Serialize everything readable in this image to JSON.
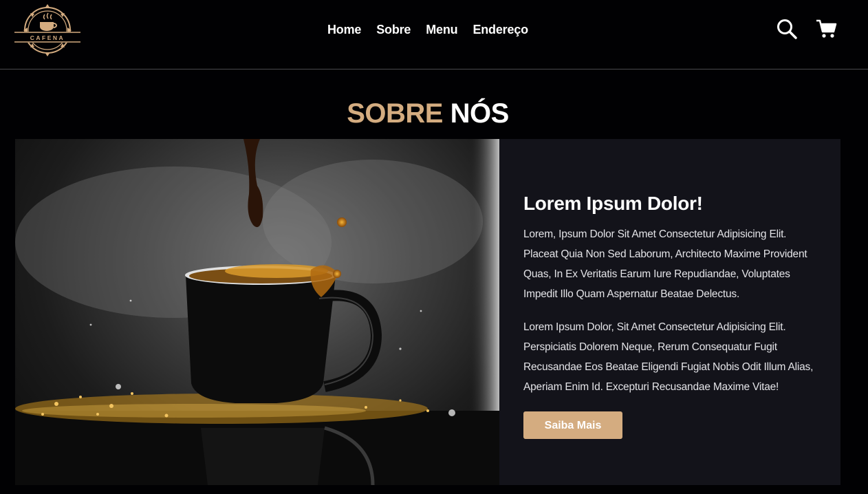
{
  "brand": {
    "logo_text": "CAFENA"
  },
  "nav": {
    "items": [
      {
        "label": "Home"
      },
      {
        "label": "Sobre"
      },
      {
        "label": "Menu"
      },
      {
        "label": "Endereço"
      }
    ]
  },
  "header_icons": [
    "search-icon",
    "shopping-cart-icon"
  ],
  "about": {
    "title_accent": "SOBRE",
    "title_rest": "NÓS",
    "heading": "Lorem Ipsum Dolor!",
    "paragraphs": [
      "Lorem, Ipsum Dolor Sit Amet Consectetur Adipisicing Elit. Placeat Quia Non Sed Laborum, Architecto Maxime Provident Quas, In Ex Veritatis Earum Iure Repudiandae, Voluptates Impedit Illo Quam Aspernatur Beatae Delectus.",
      "Lorem Ipsum Dolor, Sit Amet Consectetur Adipisicing Elit. Perspiciatis Dolorem Neque, Rerum Consequatur Fugit Recusandae Eos Beatae Eligendi Fugiat Nobis Odit Illum Alias, Aperiam Enim Id. Excepturi Recusandae Maxime Vitae!"
    ],
    "button_label": "Saiba Mais"
  },
  "colors": {
    "accent": "#d4ac80",
    "background": "#010103",
    "panel": "#13131a"
  }
}
